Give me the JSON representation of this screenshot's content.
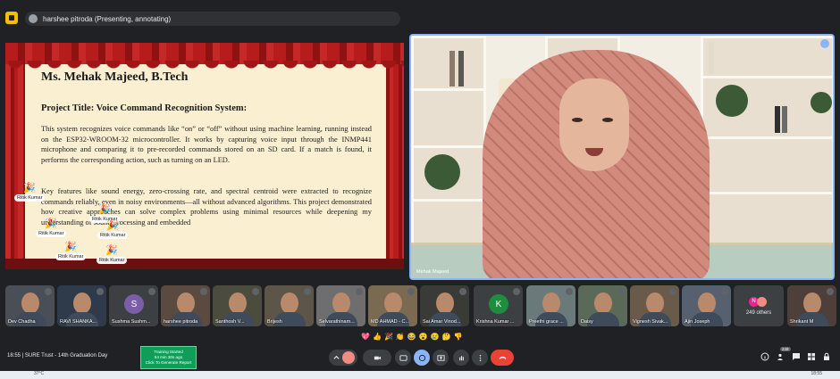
{
  "topbar": {
    "presenter": "harshee pitroda (Presenting, annotating)"
  },
  "slide": {
    "heading": "Ms. Mehak Majeed, B.Tech",
    "subtitle": "Project Title: Voice Command Recognition System:",
    "paragraph1": "This system recognizes voice commands like “on” or “off” without using machine learning, running instead on the ESP32-WROOM-32 microcontroller. It works by capturing voice input through the INMP441 microphone and comparing it to pre-recorded commands stored on an SD card. If a match is found, it performs the corresponding action, such as turning on an LED.",
    "paragraph2": "Key features like sound energy, zero-crossing rate, and spectral centroid were extracted to recognize commands reliably, even in noisy environments—all without advanced algorithms. This project demonstrated how creative approaches can solve complex problems using minimal resources while deepening my understanding of sound processing and embedded",
    "reactions": [
      {
        "emoji": "🎉",
        "name": "Ritik Kumar"
      },
      {
        "emoji": "🎉",
        "name": "Ritik Kumar"
      },
      {
        "emoji": "🎉",
        "name": "Ritik Kumar"
      },
      {
        "emoji": "🎉",
        "name": "Ritik Kumar"
      },
      {
        "emoji": "🎉",
        "name": "Ritik Kumar"
      },
      {
        "emoji": "🎉",
        "name": "Ritik Kumar"
      }
    ]
  },
  "main_video": {
    "name": "Mehak Majeed"
  },
  "participants": [
    {
      "name": "Dev Chadha",
      "bg": "#4a4f57"
    },
    {
      "name": "RAVI SHANKA...",
      "bg": "#2f3b4a"
    },
    {
      "name": "Sushma Sushm...",
      "bg": "#3c4043",
      "avatar": "S",
      "avatar_color": "#7b5ea7"
    },
    {
      "name": "harshee pitroda",
      "bg": "#5a4a3f"
    },
    {
      "name": "Santhosh V...",
      "bg": "#4b4b3e"
    },
    {
      "name": "Brijesh",
      "bg": "#5d5548"
    },
    {
      "name": "Selvarathinam...",
      "bg": "#6e6e6e"
    },
    {
      "name": "MD AHMAD - C...",
      "bg": "#7a6a52"
    },
    {
      "name": "Sai Amar Vinod...",
      "bg": "#3a3a36"
    },
    {
      "name": "Krishna Kumar ...",
      "bg": "#3c4043",
      "avatar": "K",
      "avatar_color": "#1e8e3e"
    },
    {
      "name": "Preethi grace ...",
      "bg": "#6a7a7a"
    },
    {
      "name": "Daisy",
      "bg": "#5b6a58"
    },
    {
      "name": "Vignesh Sivak...",
      "bg": "#6a5a4a"
    },
    {
      "name": "Ajin Joseph",
      "bg": "#56606e"
    }
  ],
  "others": {
    "count_label": "249 others",
    "avatars": [
      {
        "letter": "N",
        "color": "#e52592"
      },
      {
        "letter": "",
        "color": "#f28b82"
      }
    ]
  },
  "last_tile": {
    "name": "Shrikant M",
    "bg": "#4e3f3a"
  },
  "reaction_bar": [
    "💖",
    "👍",
    "🎉",
    "👏",
    "😂",
    "😮",
    "😢",
    "🤔",
    "👎"
  ],
  "bottom": {
    "time": "18:55",
    "meeting": "SURE Trust - 14th Graduation Day",
    "training_line1": "Training Started",
    "training_line2": "54 min 30s ago",
    "training_line3": "Click To Generate Report",
    "badge": "249"
  },
  "taskbar": {
    "weather": "37°C",
    "clock": "18:55"
  }
}
